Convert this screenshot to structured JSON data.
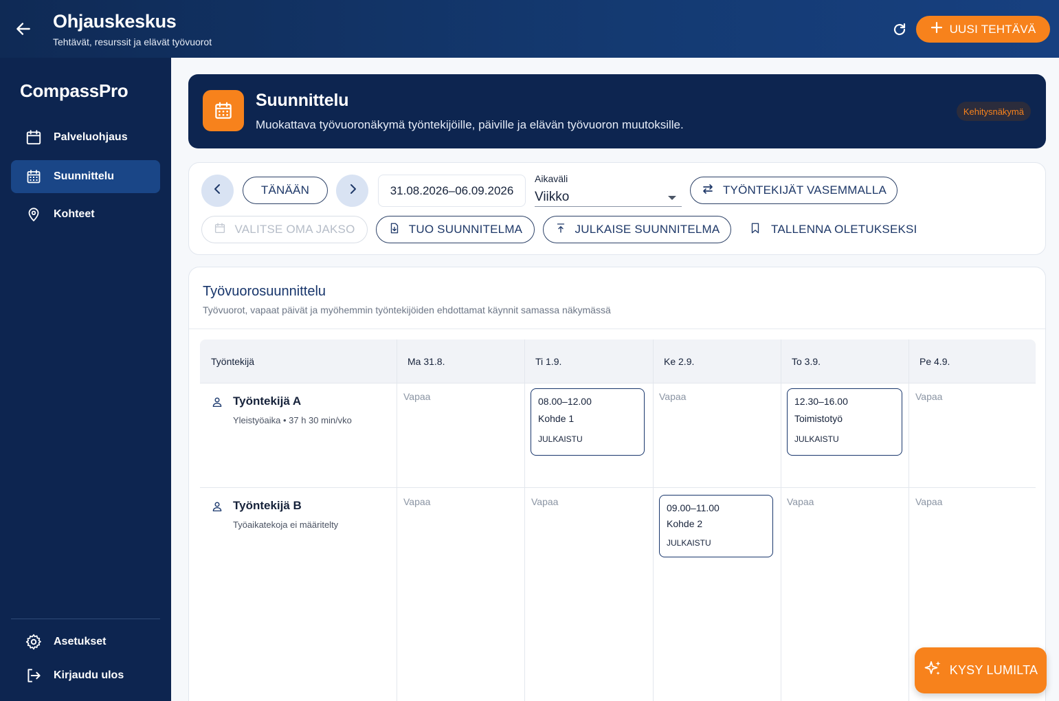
{
  "header": {
    "title": "Ohjauskeskus",
    "subtitle": "Tehtävät, resurssit ja elävät työvuorot",
    "new_task_label": "UUSI TEHTÄVÄ"
  },
  "sidebar": {
    "brand": "CompassPro",
    "items": [
      {
        "label": "Palveluohjaus",
        "icon": "calendar-icon"
      },
      {
        "label": "Suunnittelu",
        "icon": "calendar-grid-icon",
        "active": true
      },
      {
        "label": "Kohteet",
        "icon": "location-pin-icon"
      }
    ],
    "bottom": [
      {
        "label": "Asetukset",
        "icon": "gear-icon"
      },
      {
        "label": "Kirjaudu ulos",
        "icon": "logout-icon"
      }
    ]
  },
  "hero": {
    "title": "Suunnittelu",
    "description": "Muokattava työvuoronäkymä työntekijöille, päiville ja elävän työvuoron muutoksille.",
    "badge": "Kehitysnäkymä"
  },
  "toolbar": {
    "today": "TÄNÄÄN",
    "date_range": "31.08.2026–06.09.2026",
    "period_label": "Aikaväli",
    "period_value": "Viikko",
    "employees_left": "TYÖNTEKIJÄT VASEMMALLA",
    "custom_period": "VALITSE OMA JAKSO",
    "import_plan": "TUO SUUNNITELMA",
    "publish_plan": "JULKAISE SUUNNITELMA",
    "save_default": "TALLENNA OLETUKSEKSI"
  },
  "schedule": {
    "title": "Työvuorosuunnittelu",
    "subtitle": "Työvuorot, vapaat päivät ja myöhemmin työntekijöiden ehdottamat käynnit samassa näkymässä",
    "columns": [
      "Työntekijä",
      "Ma 31.8.",
      "Ti 1.9.",
      "Ke 2.9.",
      "To 3.9.",
      "Pe 4.9."
    ],
    "rows": [
      {
        "name": "Työntekijä A",
        "meta": "Yleistyöaika • 37 h 30 min/vko",
        "cells": [
          {
            "free": "Vapaa"
          },
          {
            "time": "08.00–12.00",
            "place": "Kohde 1",
            "status": "JULKAISTU"
          },
          {
            "free": "Vapaa"
          },
          {
            "time": "12.30–16.00",
            "place": "Toimistotyö",
            "status": "JULKAISTU"
          },
          {
            "free": "Vapaa"
          }
        ]
      },
      {
        "name": "Työntekijä B",
        "meta": "Työaikatekoja ei määritelty",
        "cells": [
          {
            "free": "Vapaa"
          },
          {
            "free": "Vapaa"
          },
          {
            "time": "09.00–11.00",
            "place": "Kohde 2",
            "status": "JULKAISTU"
          },
          {
            "free": "Vapaa"
          },
          {
            "free": "Vapaa"
          }
        ]
      }
    ]
  },
  "fab": {
    "label": "KYSY LUMILTA"
  },
  "colors": {
    "accent": "#f7821c",
    "navy": "#0d2550",
    "active_nav": "#1a4687"
  }
}
